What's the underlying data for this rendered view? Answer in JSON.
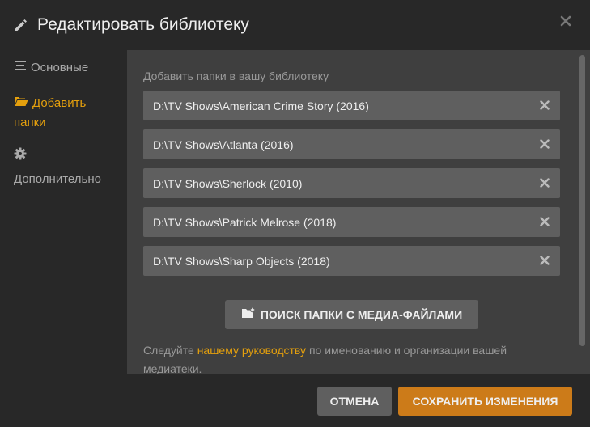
{
  "header": {
    "title": "Редактировать библиотеку",
    "pencil_icon": "pencil-icon",
    "close_icon": "close-icon"
  },
  "sidebar": {
    "items": [
      {
        "label": "Основные",
        "icon": "list-icon",
        "active": false
      },
      {
        "label": "Добавить папки",
        "icon": "folder-open-icon",
        "active": true
      },
      {
        "label": "Дополнительно",
        "icon": "gear-icon",
        "active": false
      }
    ]
  },
  "main": {
    "section_label": "Добавить папки в вашу библиотеку",
    "folders": [
      {
        "path": "D:\\TV Shows\\American Crime Story (2016)"
      },
      {
        "path": "D:\\TV Shows\\Atlanta (2016)"
      },
      {
        "path": "D:\\TV Shows\\Sherlock (2010)"
      },
      {
        "path": "D:\\TV Shows\\Patrick Melrose (2018)"
      },
      {
        "path": "D:\\TV Shows\\Sharp Objects (2018)"
      }
    ],
    "browse_button": "ПОИСК ПАПКИ С МЕДИА-ФАЙЛАМИ",
    "help": {
      "prefix": "Следуйте ",
      "link": "нашему руководству",
      "suffix": " по именованию и организации вашей медиатеки."
    }
  },
  "footer": {
    "cancel_label": "ОТМЕНА",
    "save_label": "СОХРАНИТЬ ИЗМЕНЕНИЯ"
  },
  "colors": {
    "accent": "#e5a00d",
    "save_button": "#cc7b19",
    "row_bg": "#5f5f5f",
    "content_bg": "#3f3f3f",
    "frame_bg": "#282828"
  }
}
